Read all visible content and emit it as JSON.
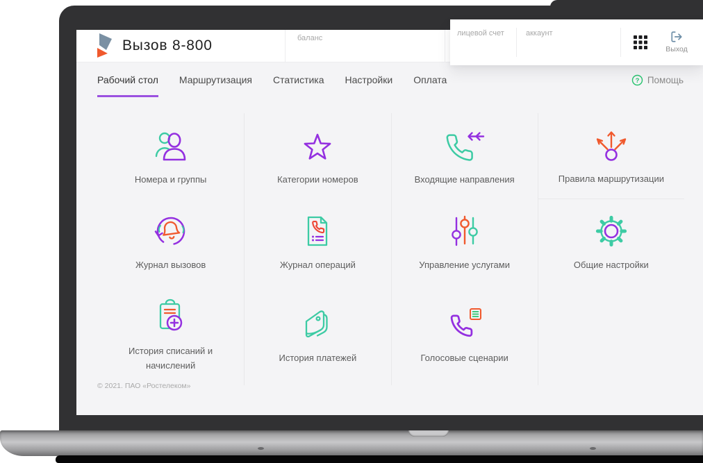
{
  "window": {
    "app_title": "Вызов 8-800"
  },
  "header": {
    "brand": "Вызов 8-800",
    "balance_label": "баланс",
    "personal_account_label": "лицевой счет",
    "account_label": "аккаунт",
    "logout_label": "Выход"
  },
  "nav": {
    "tabs": [
      {
        "label": "Рабочий стол",
        "active": true
      },
      {
        "label": "Маршрутизация",
        "active": false
      },
      {
        "label": "Статистика",
        "active": false
      },
      {
        "label": "Настройки",
        "active": false
      },
      {
        "label": "Оплата",
        "active": false
      }
    ],
    "help_label": "Помощь"
  },
  "tiles": [
    {
      "label": "Номера и группы",
      "icon": "people-icon"
    },
    {
      "label": "Категории номеров",
      "icon": "star-icon"
    },
    {
      "label": "Входящие направления",
      "icon": "incoming-call-icon"
    },
    {
      "label": "Правила маршрутизации",
      "icon": "routing-icon"
    },
    {
      "label": "Журнал вызовов",
      "icon": "call-log-icon"
    },
    {
      "label": "Журнал операций",
      "icon": "operations-log-icon"
    },
    {
      "label": "Управление услугами",
      "icon": "services-sliders-icon"
    },
    {
      "label": "Общие настройки",
      "icon": "settings-gear-icon"
    },
    {
      "label": "История списаний и начислений",
      "icon": "charges-history-icon"
    },
    {
      "label": "История платежей",
      "icon": "payments-history-icon"
    },
    {
      "label": "Голосовые сценарии",
      "icon": "voice-scenarios-icon"
    }
  ],
  "footer": {
    "copyright": "© 2021. ПАО «Ростелеком»"
  },
  "colors": {
    "purple": "#9430E0",
    "teal": "#3DCBA4",
    "orange": "#F0592D",
    "red_orange": "#EF4535",
    "tab_underline": "#9B51E0",
    "help_green": "#27C46F",
    "exit_blue": "#6E8FA8",
    "logo_slate": "#7A90A3",
    "logo_orange": "#F0592D",
    "icon_dark": "#1C1C1E"
  }
}
